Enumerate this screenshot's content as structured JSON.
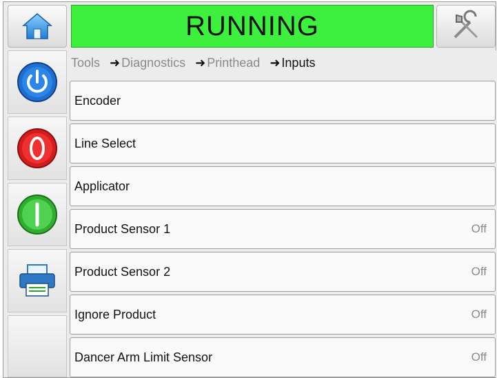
{
  "header": {
    "status": "RUNNING",
    "status_color": "#3ef03e",
    "home_icon": "home-icon",
    "tools_icon": "tools-icon"
  },
  "sidebar": {
    "items": [
      {
        "name": "power-button",
        "icon": "power-icon",
        "color": "#1f6fd1"
      },
      {
        "name": "stop-button",
        "icon": "stop-icon",
        "color": "#e02020"
      },
      {
        "name": "start-button",
        "icon": "start-icon",
        "color": "#3cc33c"
      },
      {
        "name": "print-button",
        "icon": "printer-icon",
        "color": "#2e78c4"
      }
    ]
  },
  "breadcrumb": {
    "items": [
      "Tools",
      "Diagnostics",
      "Printhead",
      "Inputs"
    ]
  },
  "inputs": [
    {
      "label": "Encoder",
      "value": ""
    },
    {
      "label": "Line Select",
      "value": ""
    },
    {
      "label": "Applicator",
      "value": ""
    },
    {
      "label": "Product Sensor 1",
      "value": "Off"
    },
    {
      "label": "Product Sensor 2",
      "value": "Off"
    },
    {
      "label": "Ignore Product",
      "value": "Off"
    },
    {
      "label": "Dancer Arm Limit Sensor",
      "value": "Off"
    }
  ]
}
